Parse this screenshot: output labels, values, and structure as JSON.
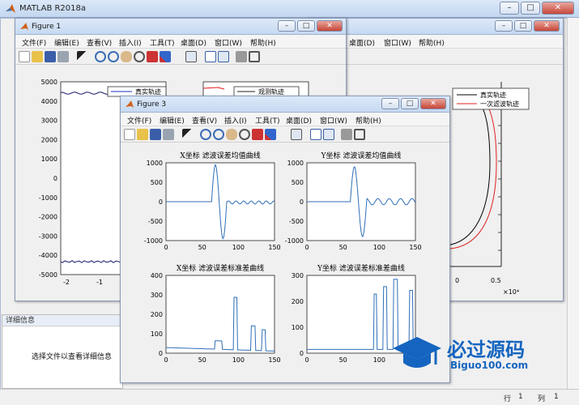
{
  "app": {
    "title": "MATLAB R2018a"
  },
  "window_buttons": {
    "minimize": "–",
    "maximize": "□",
    "close": "✕"
  },
  "detail_panel": {
    "header": "详细信息",
    "text": "选择文件以查看详细信息"
  },
  "status_bar": {
    "row_label": "行",
    "row_value": "1",
    "col_label": "列",
    "col_value": "1"
  },
  "menu": [
    "文件(F)",
    "编辑(E)",
    "查看(V)",
    "插入(I)",
    "工具(T)",
    "桌面(D)",
    "窗口(W)",
    "帮助(H)"
  ],
  "figure1": {
    "title": "Figure 1",
    "left_axes": {
      "legend": [
        "真实轨迹"
      ],
      "yticks": [
        "5000",
        "4000",
        "3000",
        "2000",
        "1000",
        "0",
        "-1000",
        "-2000",
        "-3000",
        "-4000",
        "-5000"
      ],
      "xticks": [
        "-2",
        "-1"
      ]
    },
    "right_axes": {
      "legend": [
        "观测轨迹"
      ]
    }
  },
  "figure_behind": {
    "legend": [
      "真实轨迹",
      "一次滤波轨迹"
    ],
    "xticks": [
      "0",
      "0.5"
    ],
    "exponent": "×10⁴"
  },
  "figure3": {
    "title": "Figure 3",
    "subplots": [
      {
        "title": "X坐标 滤波误差均值曲线",
        "yticks": [
          "1000",
          "500",
          "0",
          "-500",
          "-1000"
        ],
        "xticks": [
          "0",
          "50",
          "100",
          "150"
        ]
      },
      {
        "title": "Y坐标 滤波误差均值曲线",
        "yticks": [
          "1000",
          "500",
          "0",
          "-500",
          "-1000"
        ],
        "xticks": [
          "0",
          "50",
          "100",
          "150"
        ]
      },
      {
        "title": "X坐标 滤波误差标准差曲线",
        "yticks": [
          "400",
          "300",
          "200",
          "100",
          "0"
        ],
        "xticks": [
          "0",
          "50",
          "100",
          "150"
        ]
      },
      {
        "title": "Y坐标 滤波误差标准差曲线",
        "yticks": [
          "300",
          "200",
          "100",
          "0"
        ],
        "xticks": [
          "0",
          "50",
          "100",
          "150"
        ]
      }
    ]
  },
  "colors": {
    "line_blue": "#2f6fb8",
    "true_track": "#000000",
    "filtered_track": "#e02020",
    "observed_track": "#e02020"
  },
  "watermark": {
    "main": "必过源码",
    "sub": "Biguo100.com"
  }
}
